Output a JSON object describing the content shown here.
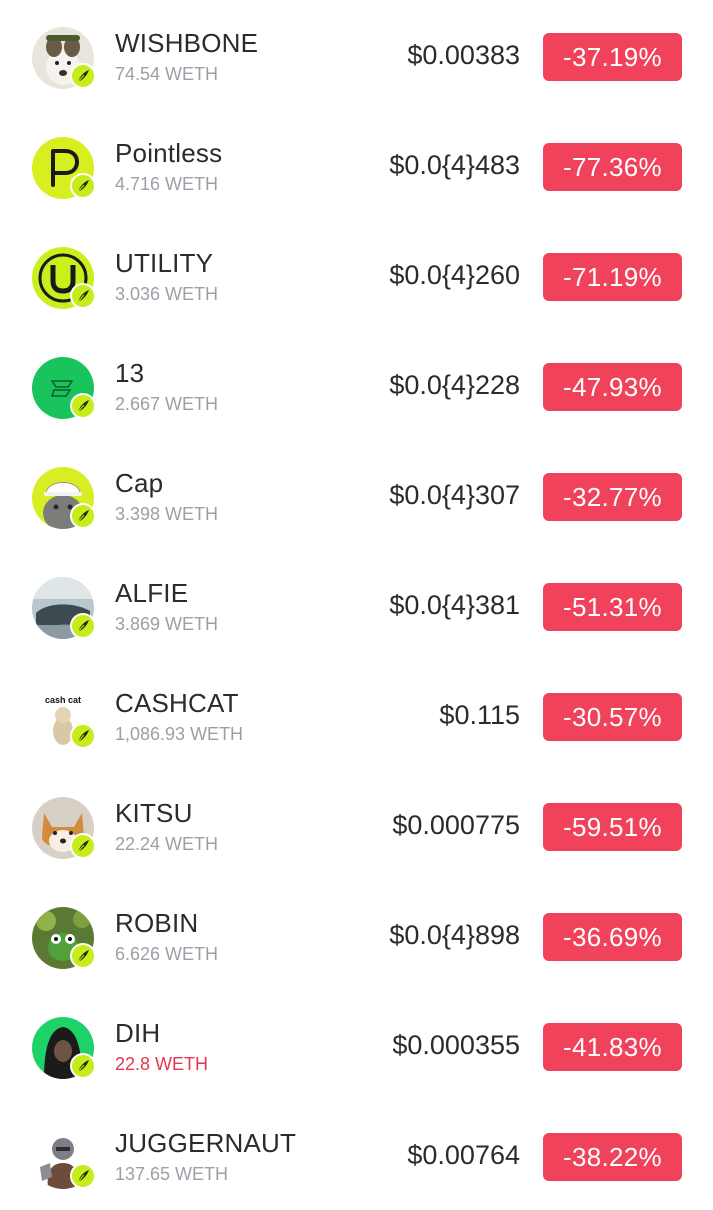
{
  "tokens": [
    {
      "name": "WISHBONE",
      "volume": "74.54 WETH",
      "price": "$0.00383",
      "change": "-37.19%",
      "avatar_icon": "dog-avatar-icon"
    },
    {
      "name": "Pointless",
      "volume": "4.716 WETH",
      "price": "$0.0{4}483",
      "change": "-77.36%",
      "avatar_icon": "letter-p-avatar-icon"
    },
    {
      "name": "UTILITY",
      "volume": "3.036 WETH",
      "price": "$0.0{4}260",
      "change": "-71.19%",
      "avatar_icon": "utility-logo-avatar-icon"
    },
    {
      "name": "13",
      "volume": "2.667 WETH",
      "price": "$0.0{4}228",
      "change": "-47.93%",
      "avatar_icon": "green-logo-avatar-icon"
    },
    {
      "name": "Cap",
      "volume": "3.398 WETH",
      "price": "$0.0{4}307",
      "change": "-32.77%",
      "avatar_icon": "cat-with-cap-avatar-icon"
    },
    {
      "name": "ALFIE",
      "volume": "3.869 WETH",
      "price": "$0.0{4}381",
      "change": "-51.31%",
      "avatar_icon": "seal-avatar-icon"
    },
    {
      "name": "CASHCAT",
      "volume": "1,086.93 WETH",
      "price": "$0.115",
      "change": "-30.57%",
      "avatar_icon": "cash-cat-avatar-icon",
      "avatar_text": "cash cat"
    },
    {
      "name": "KITSU",
      "volume": "22.24 WETH",
      "price": "$0.000775",
      "change": "-59.51%",
      "avatar_icon": "shiba-avatar-icon"
    },
    {
      "name": "ROBIN",
      "volume": "6.626 WETH",
      "price": "$0.0{4}898",
      "change": "-36.69%",
      "avatar_icon": "frog-avatar-icon"
    },
    {
      "name": "DIH",
      "volume": "22.8 WETH",
      "price": "$0.000355",
      "change": "-41.83%",
      "avatar_icon": "hooded-figure-avatar-icon"
    },
    {
      "name": "JUGGERNAUT",
      "volume": "137.65 WETH",
      "price": "$0.00764",
      "change": "-38.22%",
      "avatar_icon": "warrior-avatar-icon"
    }
  ],
  "colors": {
    "negative_badge": "#f1425c",
    "volume_text": "#9aa0a6",
    "volume_text_alert": "#e7364f",
    "platform_badge": "#c6ec1a"
  }
}
